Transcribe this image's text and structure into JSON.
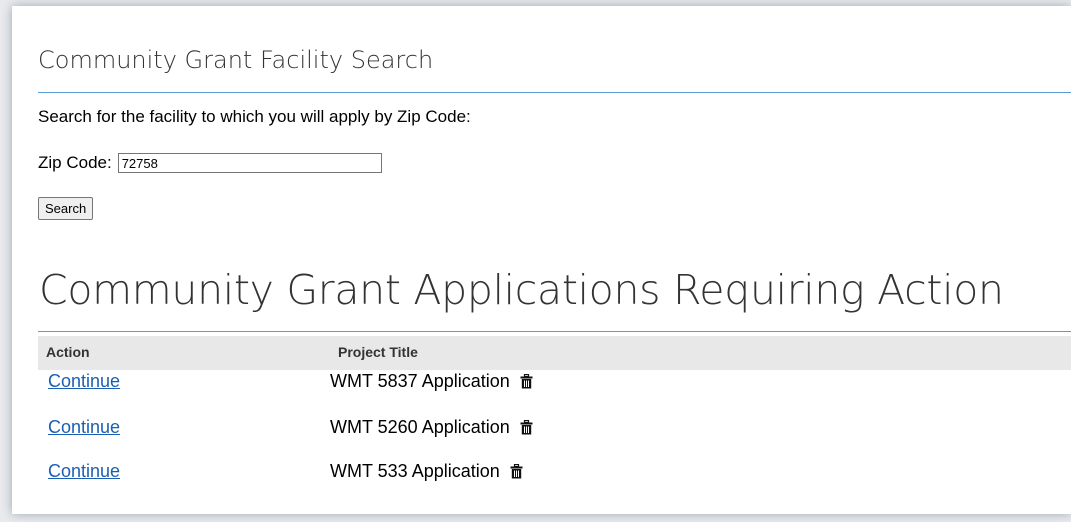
{
  "facility_search": {
    "title": "Community Grant Facility Search",
    "instructions": "Search for the facility to which you will apply by Zip Code:",
    "zip_label": "Zip Code:",
    "zip_value": "72758",
    "search_button": "Search"
  },
  "applications": {
    "title": "Community Grant Applications Requiring Action",
    "columns": [
      "Action",
      "Project Title"
    ],
    "rows": [
      {
        "action": "Continue",
        "project_title": "WMT 5837 Application",
        "icon": "trash-icon"
      },
      {
        "action": "Continue",
        "project_title": "WMT 5260 Application",
        "icon": "trash-icon"
      },
      {
        "action": "Continue",
        "project_title": "WMT 533 Application",
        "icon": "trash-icon"
      }
    ]
  },
  "colors": {
    "rule": "#5b9bd5",
    "link": "#1a5fb4",
    "header_bg": "#e8e8e8"
  }
}
